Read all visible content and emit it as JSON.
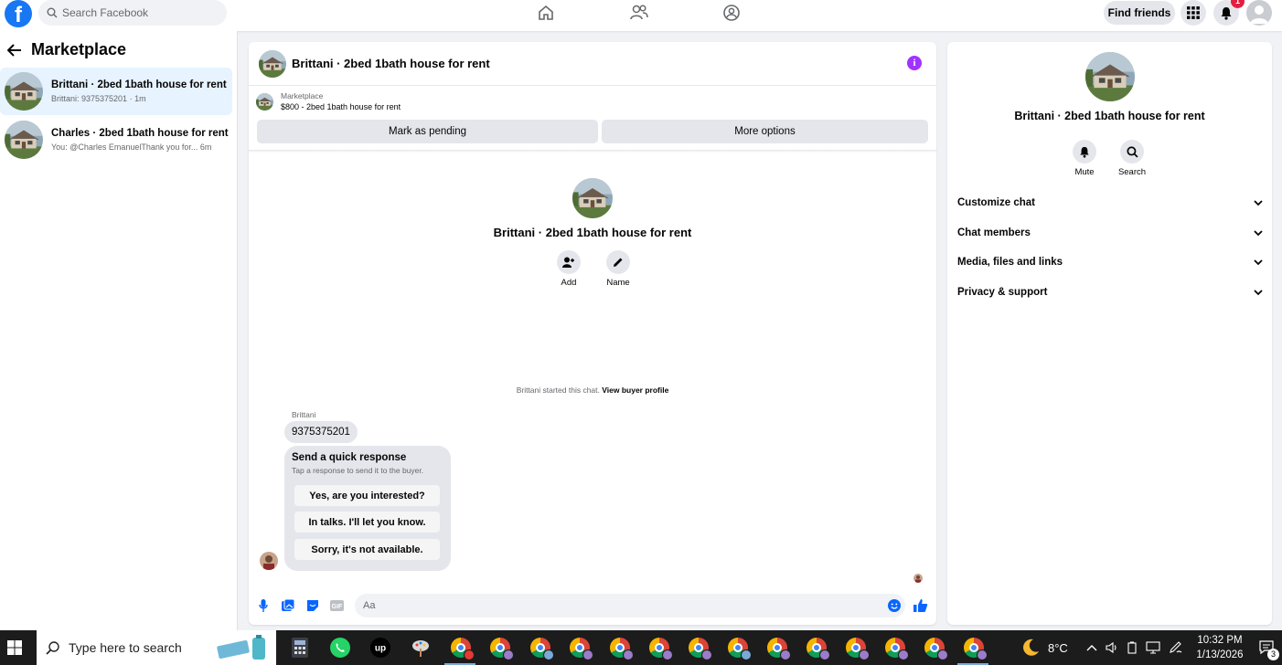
{
  "topbar": {
    "search_placeholder": "Search Facebook",
    "find_friends": "Find friends",
    "notifications_count": "1",
    "brand_color": "#1877f2"
  },
  "left": {
    "title": "Marketplace",
    "conversations": [
      {
        "name": "Brittani · 2bed 1bath house for rent",
        "preview": "Brittani: 9375375201 · 1m"
      },
      {
        "name": "Charles · 2bed 1bath house for rent",
        "preview": "You: @Charles EmanuelThank you for...  6m"
      }
    ]
  },
  "chat": {
    "title": "Brittani · 2bed 1bath house for rent",
    "marketplace_label": "Marketplace",
    "listing": "$800 - 2bed 1bath house for rent",
    "mark_pending": "Mark as pending",
    "more_options": "More options",
    "profile_name": "Brittani · 2bed 1bath house for rent",
    "add_label": "Add",
    "name_label": "Name",
    "started_text": "Brittani started this chat.",
    "view_profile": "View buyer profile",
    "sender": "Brittani",
    "message": "9375375201",
    "quick_title": "Send a quick response",
    "quick_sub": "Tap a response to send it to the buyer.",
    "quick_replies": [
      "Yes, are you interested?",
      "In talks. I'll let you know.",
      "Sorry, it's not available."
    ],
    "input_placeholder": "Aa"
  },
  "right": {
    "name": "Brittani · 2bed 1bath house for rent",
    "mute": "Mute",
    "search": "Search",
    "sections": [
      "Customize chat",
      "Chat members",
      "Media, files and links",
      "Privacy & support"
    ]
  },
  "taskbar": {
    "search_placeholder": "Type here to search",
    "weather": "8°C",
    "time": "10:32 PM",
    "date": "1/13/2026",
    "notif_count": "3"
  }
}
